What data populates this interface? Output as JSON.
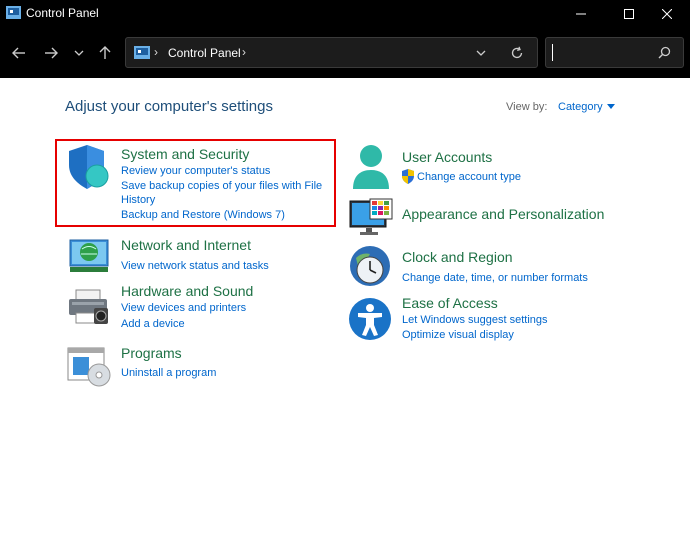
{
  "window": {
    "title": "Control Panel"
  },
  "address": {
    "crumb": "Control Panel",
    "sep": "›"
  },
  "main": {
    "heading": "Adjust your computer's settings",
    "view_by_label": "View by:",
    "view_by_value": "Category"
  },
  "left": [
    {
      "title": "System and Security",
      "links": [
        "Review your computer's status",
        "Save backup copies of your files with File",
        "History",
        "Backup and Restore (Windows 7)"
      ]
    },
    {
      "title": "Network and Internet",
      "links": [
        "View network status and tasks"
      ]
    },
    {
      "title": "Hardware and Sound",
      "links": [
        "View devices and printers",
        "Add a device"
      ]
    },
    {
      "title": "Programs",
      "links": [
        "Uninstall a program"
      ]
    }
  ],
  "right": [
    {
      "title": "User Accounts",
      "links": [
        "Change account type"
      ]
    },
    {
      "title": "Appearance and Personalization",
      "links": []
    },
    {
      "title": "Clock and Region",
      "links": [
        "Change date, time, or number formats"
      ]
    },
    {
      "title": "Ease of Access",
      "links": [
        "Let Windows suggest settings",
        "Optimize visual display"
      ]
    }
  ],
  "colors": {
    "category_title": "#1e7145",
    "link": "#0066cc",
    "highlight": "#e60000"
  }
}
